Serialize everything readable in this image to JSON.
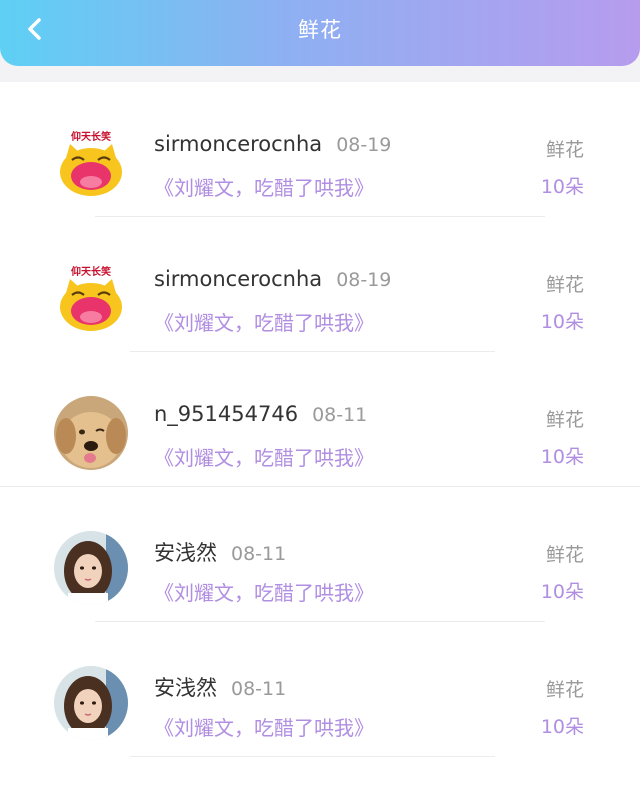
{
  "header": {
    "title": "鲜花",
    "back_icon": "chevron-left-icon",
    "gradient": [
      "#5ed0f4",
      "#b79cee"
    ]
  },
  "gifts": [
    {
      "username": "sirmoncerocnha",
      "date": "08-19",
      "message": "《刘耀文，吃醋了哄我》",
      "gift_name": "鲜花",
      "gift_count": "10朵",
      "avatar": "laughing-cat-sticker",
      "avatar_caption": "仰天长笑"
    },
    {
      "username": "sirmoncerocnha",
      "date": "08-19",
      "message": "《刘耀文，吃醋了哄我》",
      "gift_name": "鲜花",
      "gift_count": "10朵",
      "avatar": "laughing-cat-sticker",
      "avatar_caption": "仰天长笑"
    },
    {
      "username": "n_951454746",
      "date": "08-11",
      "message": "《刘耀文，吃醋了哄我》",
      "gift_name": "鲜花",
      "gift_count": "10朵",
      "avatar": "golden-retriever-photo"
    },
    {
      "username": "安浅然",
      "date": "08-11",
      "message": "《刘耀文，吃醋了哄我》",
      "gift_name": "鲜花",
      "gift_count": "10朵",
      "avatar": "girl-portrait-photo"
    },
    {
      "username": "安浅然",
      "date": "08-11",
      "message": "《刘耀文，吃醋了哄我》",
      "gift_name": "鲜花",
      "gift_count": "10朵",
      "avatar": "girl-portrait-photo"
    }
  ],
  "colors": {
    "accent_purple": "#b08ee2",
    "text_dark": "#333333",
    "text_gray": "#9a9a9a"
  }
}
